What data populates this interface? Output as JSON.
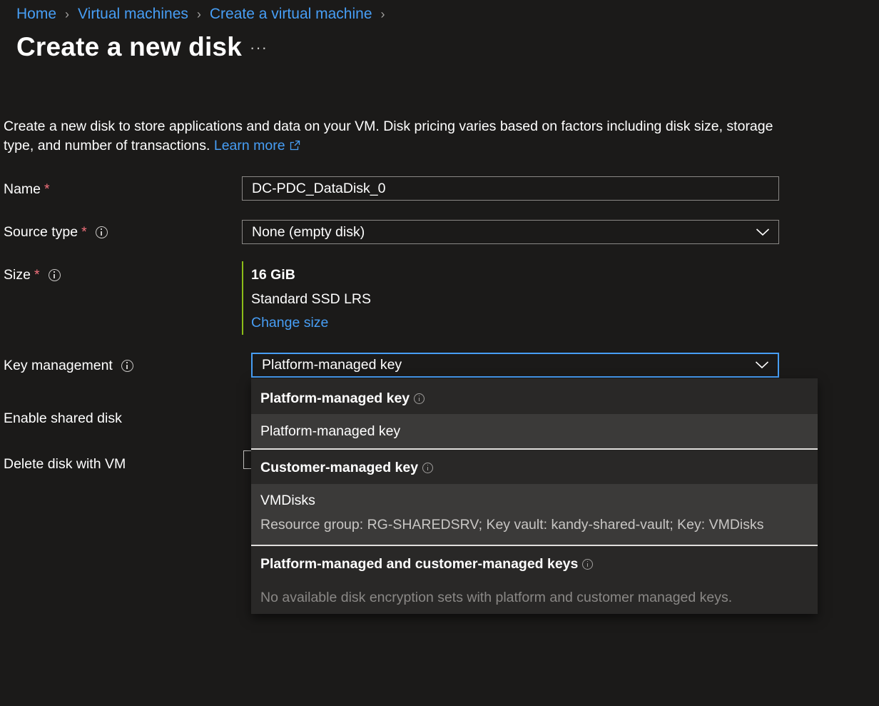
{
  "breadcrumb": [
    "Home",
    "Virtual machines",
    "Create a virtual machine"
  ],
  "page_title": "Create a new disk",
  "more_label": "···",
  "intro": {
    "text": "Create a new disk to store applications and data on your VM. Disk pricing varies based on factors including disk size, storage type, and number of transactions.",
    "link": "Learn more"
  },
  "form": {
    "name": {
      "label": "Name",
      "required": "*",
      "value": "DC-PDC_DataDisk_0"
    },
    "source_type": {
      "label": "Source type",
      "required": "*",
      "value": "None (empty disk)"
    },
    "size": {
      "label": "Size",
      "required": "*",
      "value": "16 GiB",
      "sku": "Standard SSD LRS",
      "change_link": "Change size"
    },
    "key_management": {
      "label": "Key management",
      "value": "Platform-managed key"
    },
    "shared_disk": {
      "label": "Enable shared disk"
    },
    "delete_with_vm": {
      "label": "Delete disk with VM"
    }
  },
  "dropdown": {
    "groups": [
      {
        "header": "Platform-managed key",
        "option": "Platform-managed key"
      },
      {
        "header": "Customer-managed key",
        "option": "VMDisks",
        "option_detail": "Resource group: RG-SHAREDSRV; Key vault: kandy-shared-vault; Key: VMDisks"
      },
      {
        "header": "Platform-managed and customer-managed keys",
        "empty_text": "No available disk encryption sets with platform and customer managed keys."
      }
    ]
  },
  "colors": {
    "background": "#1b1a19",
    "link": "#479ef5",
    "required": "#f1707b",
    "focus_border": "#479ef5",
    "size_accent": "#8cbd18",
    "dropdown_bg": "#292827",
    "option_selected_bg": "#3b3a39"
  }
}
